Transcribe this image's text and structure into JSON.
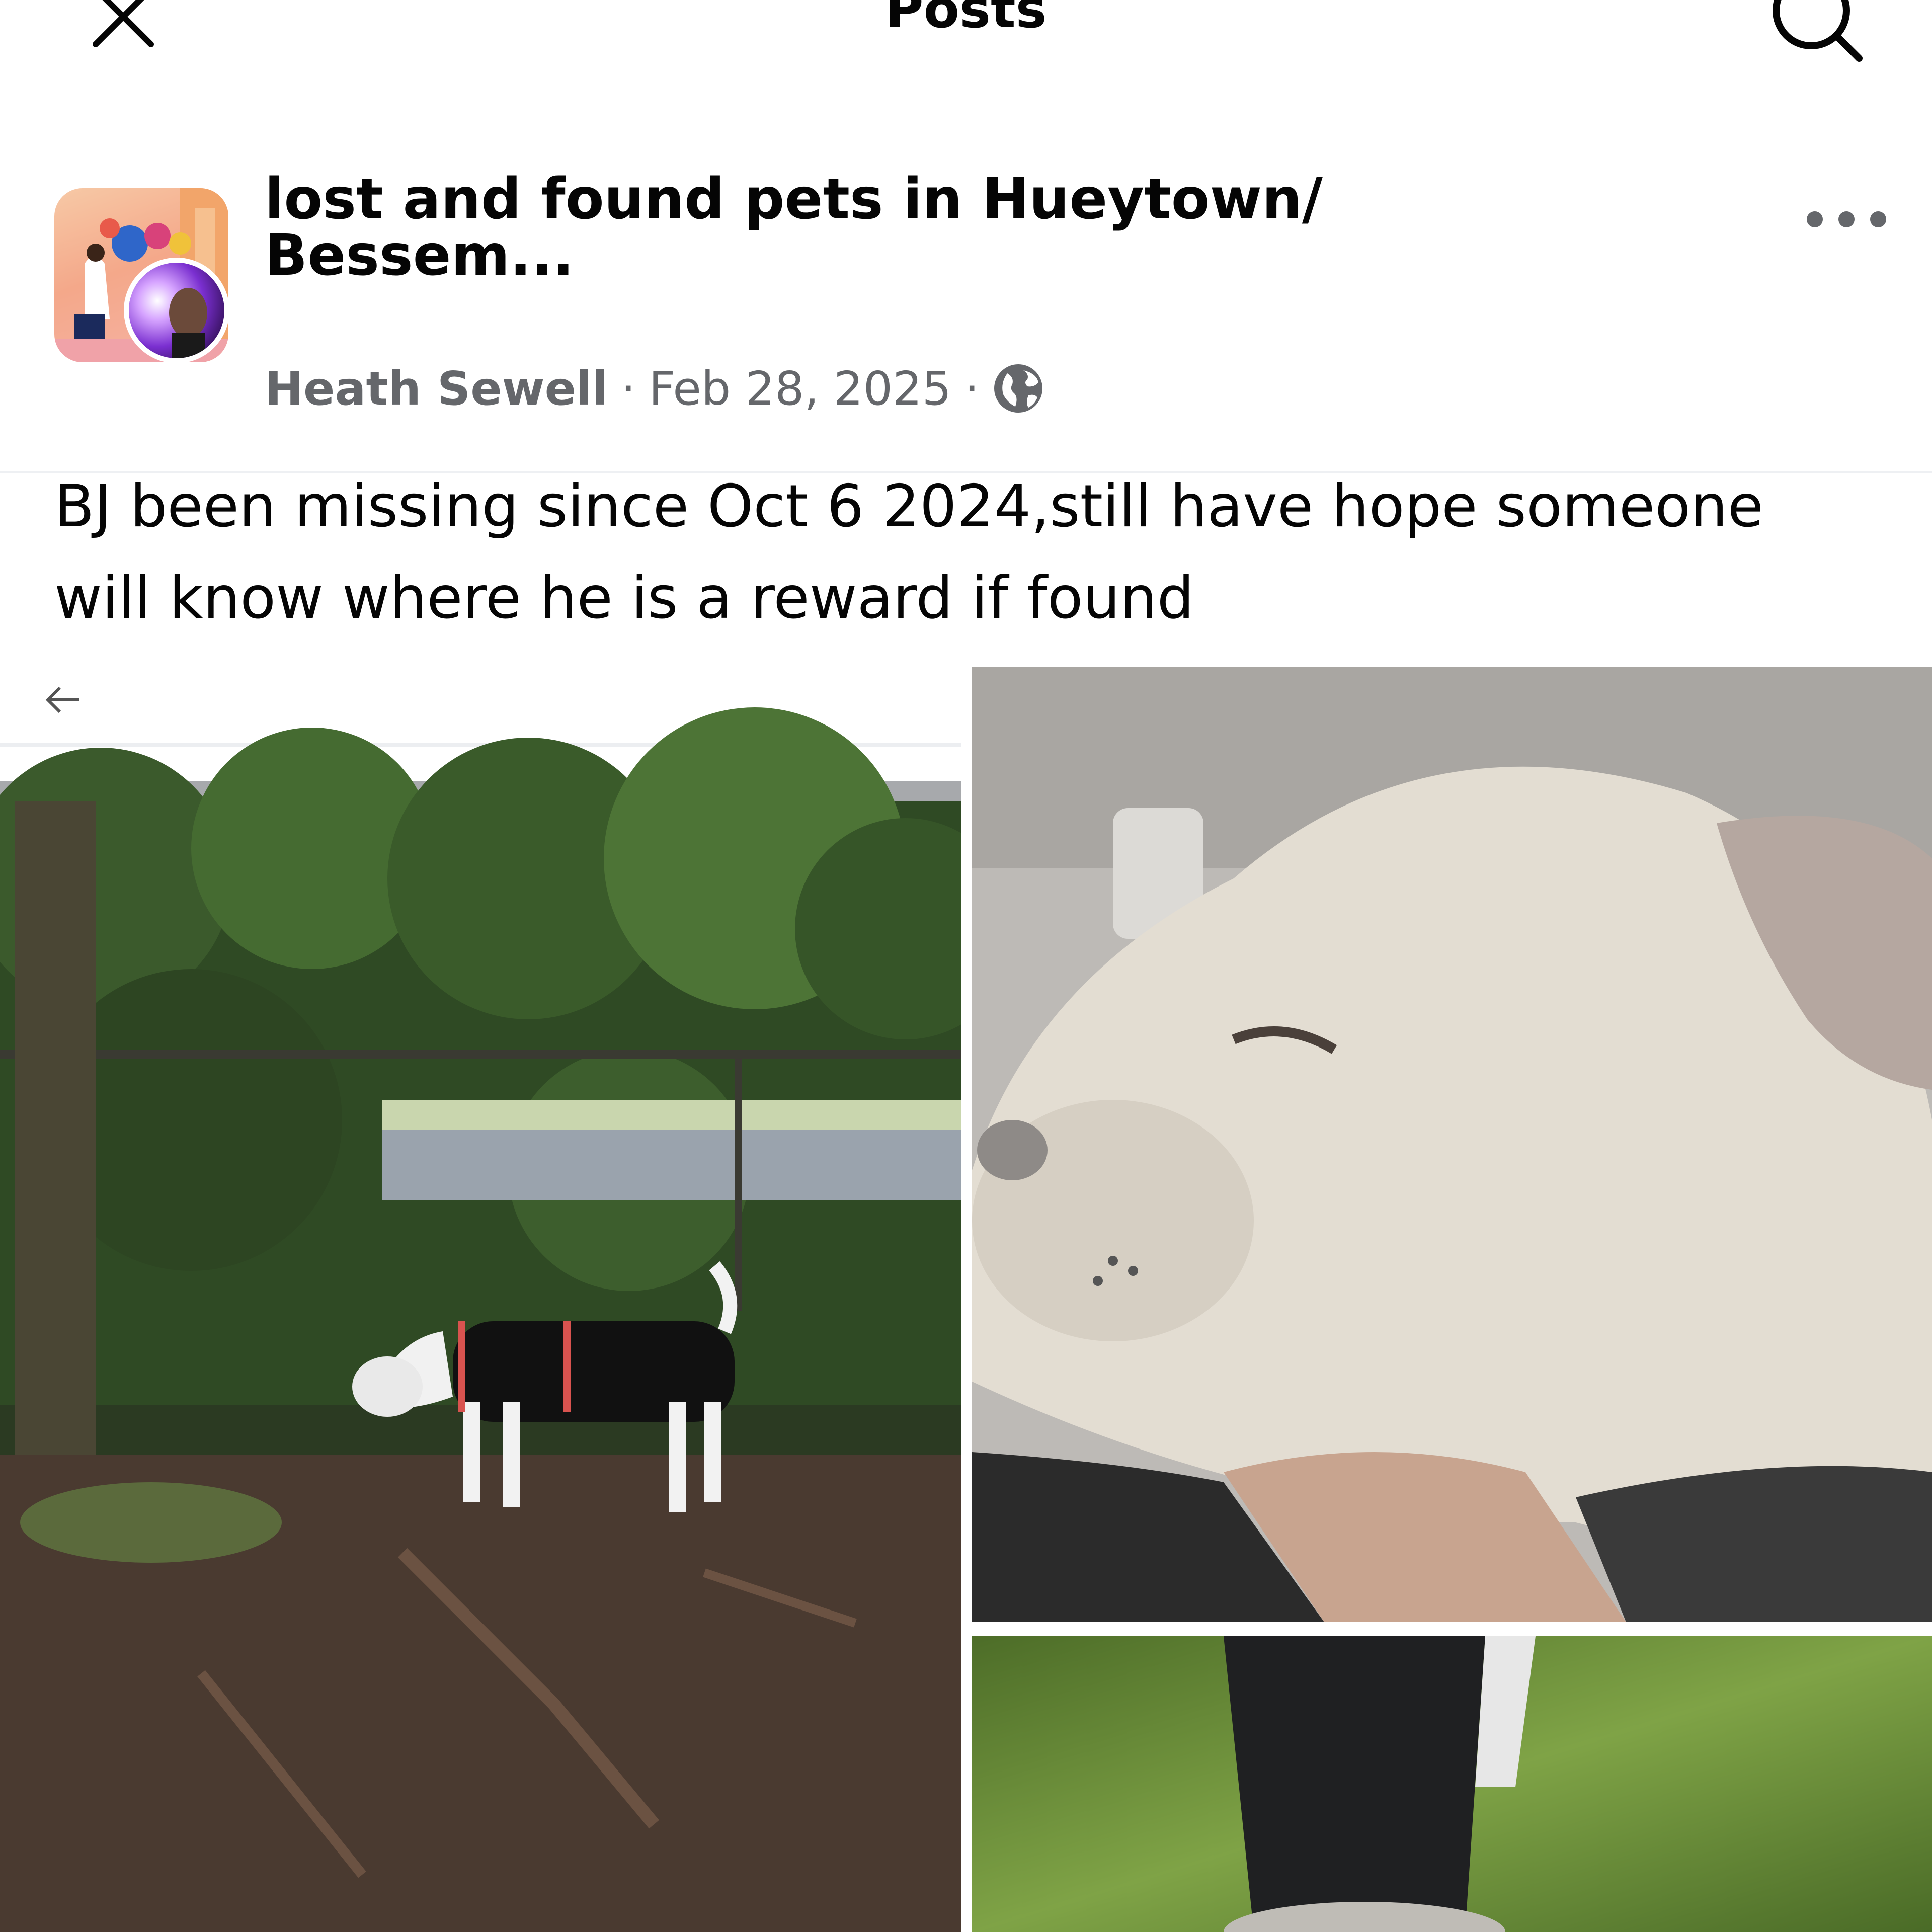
{
  "topbar": {
    "title": "Posts",
    "close_icon": "close-icon",
    "search_icon": "search-icon"
  },
  "post": {
    "group_name_line1": "lost and found pets in Hueytown/",
    "group_name_line2": "Bessem...",
    "author": "Heath Sewell",
    "separator": "·",
    "date": "Feb 28, 2025",
    "privacy_icon": "globe-icon",
    "more_icon": "more-horizontal-icon",
    "text": "BJ been missing since Oct 6 2024,still have hope someone will know where he is a reward if found"
  },
  "photos": {
    "count": 3,
    "back_arrow_icon": "back-arrow-icon"
  },
  "colors": {
    "text_primary": "#050505",
    "text_secondary": "#65676b",
    "divider": "#eef0f3",
    "background": "#ffffff"
  }
}
